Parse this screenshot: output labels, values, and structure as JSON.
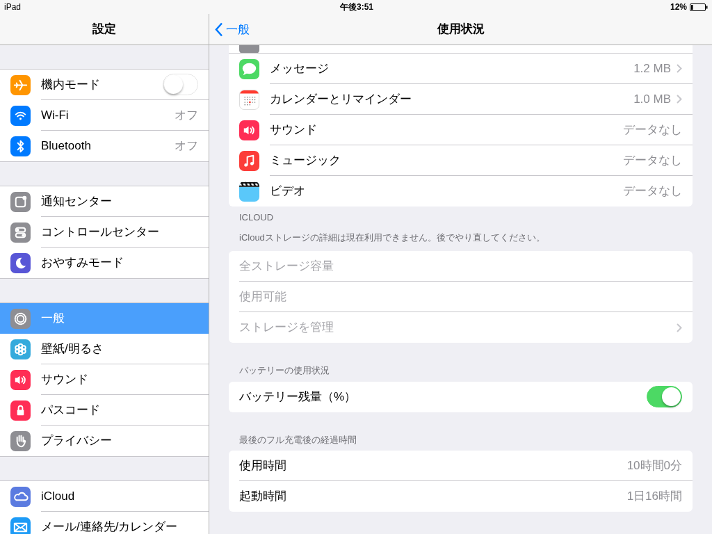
{
  "status_bar": {
    "device": "iPad",
    "time": "午後3:51",
    "battery": "12%"
  },
  "sidebar": {
    "title": "設定",
    "groups": [
      {
        "items": [
          {
            "label": "機内モード",
            "kind": "toggle",
            "on": false,
            "selected": false,
            "color": "#ff9500"
          },
          {
            "label": "Wi-Fi",
            "kind": "detail",
            "value": "オフ",
            "selected": false,
            "color": "#007aff"
          },
          {
            "label": "Bluetooth",
            "kind": "detail",
            "value": "オフ",
            "selected": false,
            "color": "#007aff"
          }
        ]
      },
      {
        "items": [
          {
            "label": "通知センター",
            "kind": "plain",
            "selected": false,
            "color": "#8e8e93"
          },
          {
            "label": "コントロールセンター",
            "kind": "plain",
            "selected": false,
            "color": "#8e8e93"
          },
          {
            "label": "おやすみモード",
            "kind": "plain",
            "selected": false,
            "color": "#5856d6"
          }
        ]
      },
      {
        "items": [
          {
            "label": "一般",
            "kind": "plain",
            "selected": true,
            "color": "#8e8e93"
          },
          {
            "label": "壁紙/明るさ",
            "kind": "plain",
            "selected": false,
            "color": "#34aadc"
          },
          {
            "label": "サウンド",
            "kind": "plain",
            "selected": false,
            "color": "#ff2d55"
          },
          {
            "label": "パスコード",
            "kind": "plain",
            "selected": false,
            "color": "#ff2d55"
          },
          {
            "label": "プライバシー",
            "kind": "plain",
            "selected": false,
            "color": "#8e8e93"
          }
        ]
      },
      {
        "items": [
          {
            "label": "iCloud",
            "kind": "plain",
            "selected": false,
            "color": "#5b7be0"
          },
          {
            "label": "メール/連絡先/カレンダー",
            "kind": "plain",
            "selected": false,
            "color": "#1d9bf6"
          }
        ]
      }
    ]
  },
  "nav": {
    "back": "一般",
    "title": "使用状況"
  },
  "apps": [
    {
      "kind": "cut",
      "color": "#8e8e93"
    },
    {
      "kind": "app",
      "label": "メッセージ",
      "value": "1.2 MB",
      "chevron": true,
      "color": "#4cd964"
    },
    {
      "kind": "app",
      "label": "カレンダーとリマインダー",
      "value": "1.0 MB",
      "chevron": true,
      "color": "#ffffff"
    },
    {
      "kind": "app",
      "label": "サウンド",
      "value": "データなし",
      "chevron": false,
      "color": "#ff2d55"
    },
    {
      "kind": "app",
      "label": "ミュージック",
      "value": "データなし",
      "chevron": false,
      "color": "#fc3d39"
    },
    {
      "kind": "app",
      "label": "ビデオ",
      "value": "データなし",
      "chevron": false,
      "color": "#5ac8fa"
    }
  ],
  "icloud": {
    "header": "ICLOUD",
    "note": "iCloudストレージの詳細は現在利用できません。後でやり直してください。",
    "rows": [
      {
        "label": "全ストレージ容量",
        "disabled": true,
        "chevron": false
      },
      {
        "label": "使用可能",
        "disabled": true,
        "chevron": false
      },
      {
        "label": "ストレージを管理",
        "disabled": true,
        "chevron": true
      }
    ]
  },
  "battery": {
    "header": "バッテリーの使用状況",
    "rows": [
      {
        "label": "バッテリー残量（%）",
        "on": true
      }
    ]
  },
  "since_charge": {
    "header": "最後のフル充電後の経過時間",
    "rows": [
      {
        "label": "使用時間",
        "value": "10時間0分"
      },
      {
        "label": "起動時間",
        "value": "1日16時間"
      }
    ]
  }
}
